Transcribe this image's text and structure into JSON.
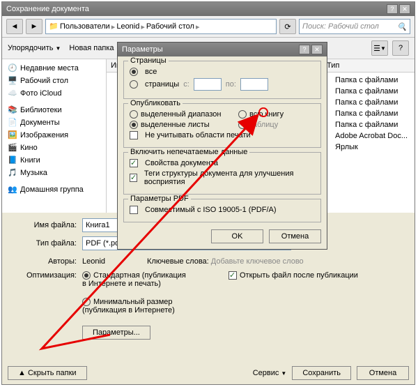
{
  "main": {
    "title": "Сохранение документа",
    "breadcrumb": [
      "Пользователи",
      "Leonid",
      "Рабочий стол"
    ],
    "search_placeholder": "Поиск: Рабочий стол",
    "organize": "Упорядочить",
    "new_folder": "Новая папка",
    "col_name": "Имя",
    "col_type": "Тип",
    "types": [
      "Папка с файлами",
      "Папка с файлами",
      "Папка с файлами",
      "Папка с файлами",
      "Папка с файлами",
      "Adobe Acrobat Doc...",
      "Ярлык"
    ],
    "filename_label": "Имя файла:",
    "filename_value": "Книга1",
    "filetype_label": "Тип файла:",
    "filetype_value": "PDF (*.pdf)",
    "authors_label": "Авторы:",
    "authors_value": "Leonid",
    "keywords_label": "Ключевые слова:",
    "keywords_value": "Добавьте ключевое слово",
    "optimize_label": "Оптимизация:",
    "opt_standard": "Стандартная (публикация в Интернете и печать)",
    "opt_min": "Минимальный размер (публикация в Интернете)",
    "open_after": "Открыть файл после публикации",
    "params_btn": "Параметры...",
    "hide_folders": "Скрыть папки",
    "service": "Сервис",
    "save": "Сохранить",
    "cancel": "Отмена"
  },
  "sidebar": {
    "recent": "Недавние места",
    "desktop": "Рабочий стол",
    "icloud": "Фото iCloud",
    "libs": "Библиотеки",
    "docs": "Документы",
    "images": "Изображения",
    "video": "Кино",
    "books": "Книги",
    "music": "Музыка",
    "homegroup": "Домашняя группа"
  },
  "dlg": {
    "title": "Параметры",
    "pages": "Страницы",
    "all": "все",
    "pages_opt": "страницы",
    "from": "с:",
    "to": "по:",
    "publish": "Опубликовать",
    "sel_range": "выделенный диапазон",
    "sel_sheets": "выделенные листы",
    "whole_book": "всю книгу",
    "table": "таблицу",
    "ignore_print": "Не учитывать области печати",
    "include_nonprint": "Включить непечатаемые данные",
    "doc_props": "Свойства документа",
    "doc_tags": "Теги структуры документа для улучшения восприятия",
    "pdf_params": "Параметры PDF",
    "iso": "Совместимый с ISO 19005-1 (PDF/A)",
    "ok": "OK",
    "cancel": "Отмена"
  }
}
